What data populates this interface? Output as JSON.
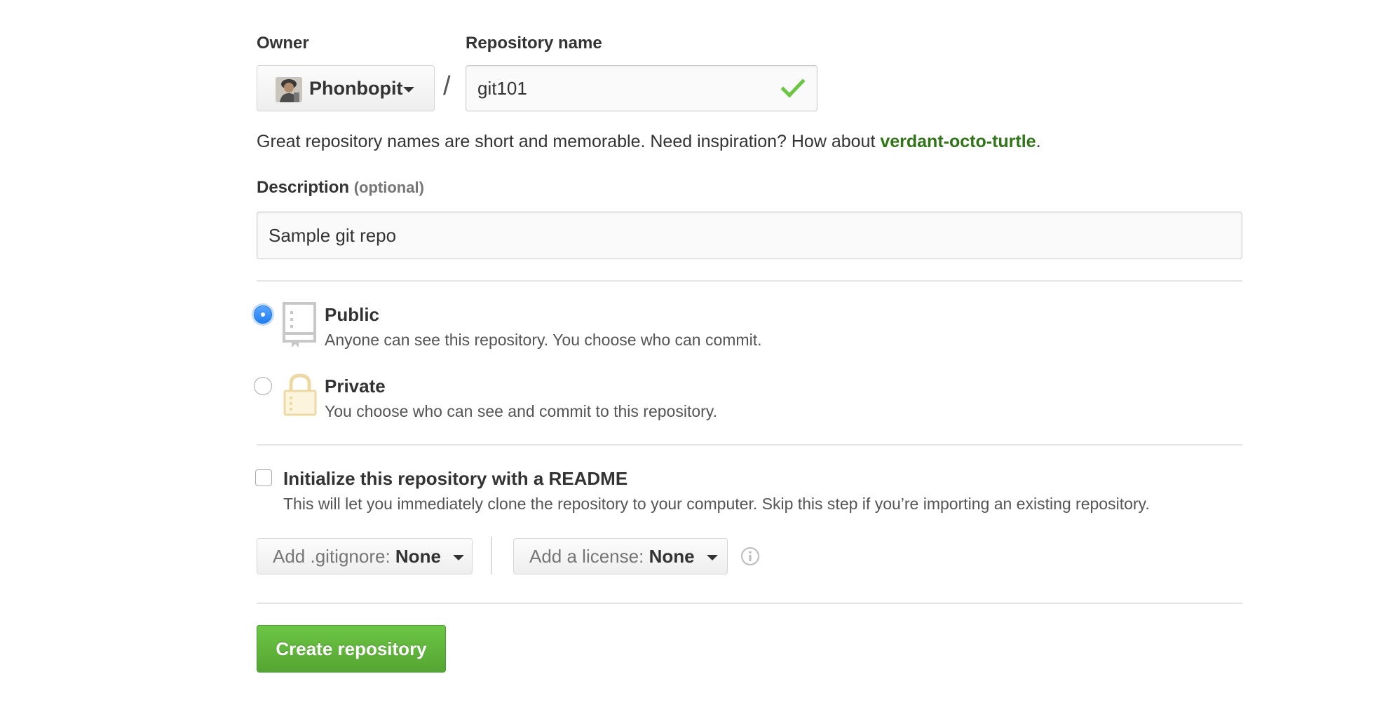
{
  "owner": {
    "label": "Owner",
    "name": "Phonbopit"
  },
  "separator": "/",
  "repo_name": {
    "label": "Repository name",
    "value": "git101",
    "valid": true
  },
  "hint": {
    "text": "Great repository names are short and memorable. Need inspiration? How about ",
    "suggestion": "verdant-octo-turtle",
    "end": "."
  },
  "description": {
    "label": "Description",
    "optional": "(optional)",
    "value": "Sample git repo"
  },
  "visibility": {
    "selected": "public",
    "public": {
      "title": "Public",
      "desc": "Anyone can see this repository. You choose who can commit.",
      "icon": "repo-book-icon"
    },
    "private": {
      "title": "Private",
      "desc": "You choose who can see and commit to this repository.",
      "icon": "lock-icon"
    }
  },
  "readme": {
    "checked": false,
    "title": "Initialize this repository with a README",
    "desc": "This will let you immediately clone the repository to your computer. Skip this step if you’re importing an existing repository."
  },
  "gitignore": {
    "prefix": "Add .gitignore:",
    "value": "None"
  },
  "license": {
    "prefix": "Add a license:",
    "value": "None"
  },
  "create_button": "Create repository",
  "colors": {
    "accent_green": "#55a532",
    "suggestion_green": "#2f7517",
    "radio_blue": "#1f7ff0",
    "check_green": "#6cc644"
  }
}
